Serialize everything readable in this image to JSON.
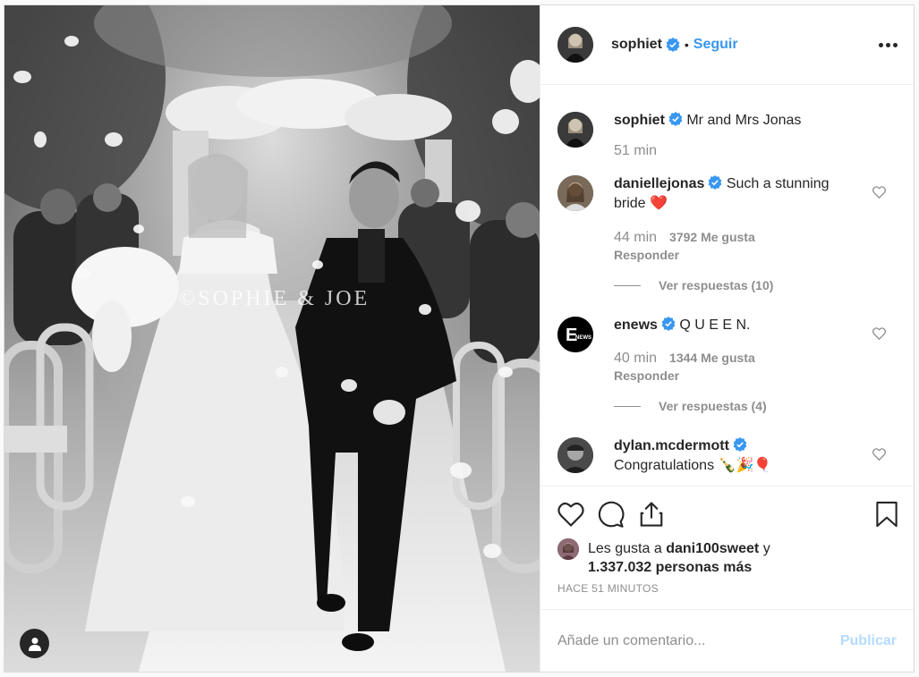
{
  "post": {
    "author": "sophiet",
    "follow_label": "Seguir",
    "dot": "•",
    "watermark": "©SOPHIE & JOE",
    "caption": {
      "username": "sophiet",
      "text": "Mr and Mrs Jonas",
      "time": "51 min"
    },
    "comments": [
      {
        "username": "daniellejonas",
        "text": "Such a stunning bride",
        "emoji": "❤️",
        "time": "44 min",
        "likes": "3792 Me gusta",
        "reply": "Responder",
        "replies": "Ver respuestas (10)"
      },
      {
        "username": "enews",
        "text": "Q U E E N.",
        "time": "40 min",
        "likes": "1344 Me gusta",
        "reply": "Responder",
        "replies": "Ver respuestas (4)"
      },
      {
        "username": "dylan.mcdermott",
        "text": "Congratulations",
        "emoji": "🍾🎉🎈"
      }
    ],
    "liked_by": {
      "prefix": "Les gusta a",
      "user": "dani100sweet",
      "connector": "y",
      "count": "1.337.032 personas más"
    },
    "timestamp": "HACE 51 MINUTOS",
    "comment_input": {
      "placeholder": "Añade un comentario..."
    },
    "publish_label": "Publicar"
  },
  "icons": {
    "verified": "verified-badge-icon",
    "more": "more-options-icon",
    "like": "heart-icon",
    "comment": "comment-icon",
    "share": "share-icon",
    "save": "bookmark-icon",
    "tag": "user-tag-icon"
  },
  "colors": {
    "link": "#3897f0",
    "verified": "#3897f0",
    "muted": "#8e8e8e",
    "publish_disabled": "#b3dbff",
    "heart": "#ed4956"
  }
}
